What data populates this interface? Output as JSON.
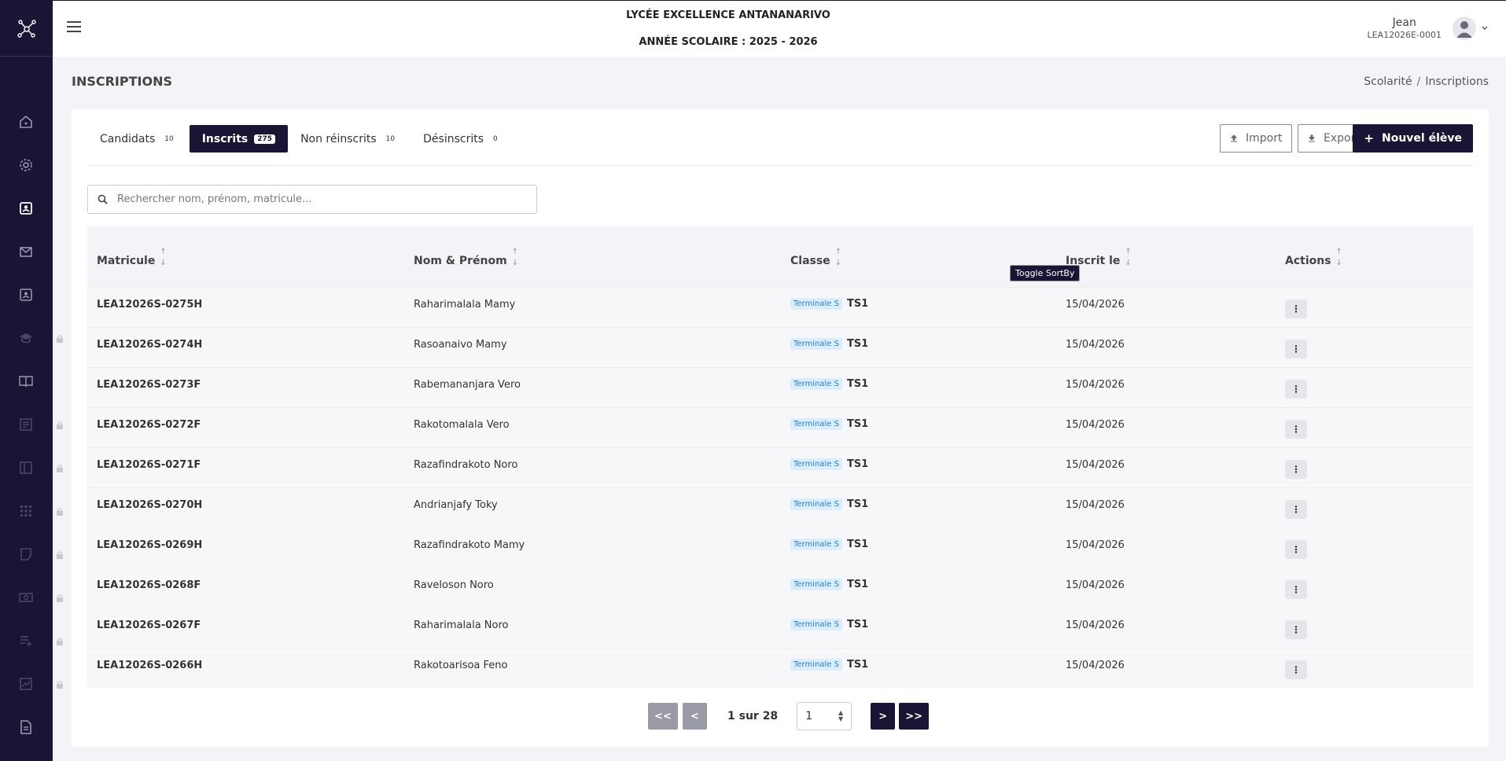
{
  "header": {
    "school_name": "LYCÉE EXCELLENCE ANTANANARIVO",
    "school_year": "ANNÉE SCOLAIRE : 2025 - 2026",
    "user_name": "Jean",
    "user_id": "LEA12026E-0001"
  },
  "page": {
    "title": "INSCRIPTIONS",
    "breadcrumb": [
      "Scolarité",
      "Inscriptions"
    ],
    "breadcrumb_sep": "/"
  },
  "tabs": [
    {
      "label": "Candidats",
      "count": "10",
      "active": false
    },
    {
      "label": "Inscrits",
      "count": "275",
      "active": true
    },
    {
      "label": "Non réinscrits",
      "count": "10",
      "active": false
    },
    {
      "label": "Désinscrits",
      "count": "0",
      "active": false
    }
  ],
  "actions": {
    "import_label": "Import",
    "export_label": "Export",
    "new_label": "Nouvel élève",
    "new_icon": "+"
  },
  "search": {
    "placeholder": "Rechercher nom, prénom, matricule..."
  },
  "table": {
    "columns": [
      "Matricule",
      "Nom & Prénom",
      "Classe",
      "Inscrit le",
      "Actions"
    ],
    "sort_up": "↑",
    "sort_down": "↓",
    "action_glyph": "⋮",
    "tooltip": "Toggle SortBy",
    "rows": [
      {
        "matricule": "LEA12026S-0275H",
        "nom": "Raharimalala Mamy",
        "classe_tag": "Terminale S",
        "classe_code": "TS1",
        "date": "15/04/2026"
      },
      {
        "matricule": "LEA12026S-0274H",
        "nom": "Rasoanaivo Mamy",
        "classe_tag": "Terminale S",
        "classe_code": "TS1",
        "date": "15/04/2026"
      },
      {
        "matricule": "LEA12026S-0273F",
        "nom": "Rabemananjara Vero",
        "classe_tag": "Terminale S",
        "classe_code": "TS1",
        "date": "15/04/2026"
      },
      {
        "matricule": "LEA12026S-0272F",
        "nom": "Rakotomalala Vero",
        "classe_tag": "Terminale S",
        "classe_code": "TS1",
        "date": "15/04/2026"
      },
      {
        "matricule": "LEA12026S-0271F",
        "nom": "Razafindrakoto Noro",
        "classe_tag": "Terminale S",
        "classe_code": "TS1",
        "date": "15/04/2026"
      },
      {
        "matricule": "LEA12026S-0270H",
        "nom": "Andrianjafy Toky",
        "classe_tag": "Terminale S",
        "classe_code": "TS1",
        "date": "15/04/2026"
      },
      {
        "matricule": "LEA12026S-0269H",
        "nom": "Razafindrakoto Mamy",
        "classe_tag": "Terminale S",
        "classe_code": "TS1",
        "date": "15/04/2026"
      },
      {
        "matricule": "LEA12026S-0268F",
        "nom": "Raveloson Noro",
        "classe_tag": "Terminale S",
        "classe_code": "TS1",
        "date": "15/04/2026"
      },
      {
        "matricule": "LEA12026S-0267F",
        "nom": "Raharimalala Noro",
        "classe_tag": "Terminale S",
        "classe_code": "TS1",
        "date": "15/04/2026"
      },
      {
        "matricule": "LEA12026S-0266H",
        "nom": "Rakotoarisoa Feno",
        "classe_tag": "Terminale S",
        "classe_code": "TS1",
        "date": "15/04/2026"
      }
    ]
  },
  "pagination": {
    "first": "<<",
    "prev": "<",
    "info": "1 sur 28",
    "current": "1",
    "next": ">",
    "last": ">>"
  },
  "sidebar": {
    "icons": [
      "home-icon",
      "gear-icon",
      "student-card-icon",
      "mail-icon",
      "id-card-icon",
      "graduation-cap-icon",
      "book-icon",
      "document-icon",
      "layout-icon",
      "grid-icon",
      "note-icon",
      "money-icon",
      "list-add-icon",
      "chart-icon",
      "file-icon"
    ]
  },
  "colors": {
    "primary": "#1a1535",
    "tag_bg": "#dbeeff",
    "tag_text": "#2b7fc8"
  }
}
